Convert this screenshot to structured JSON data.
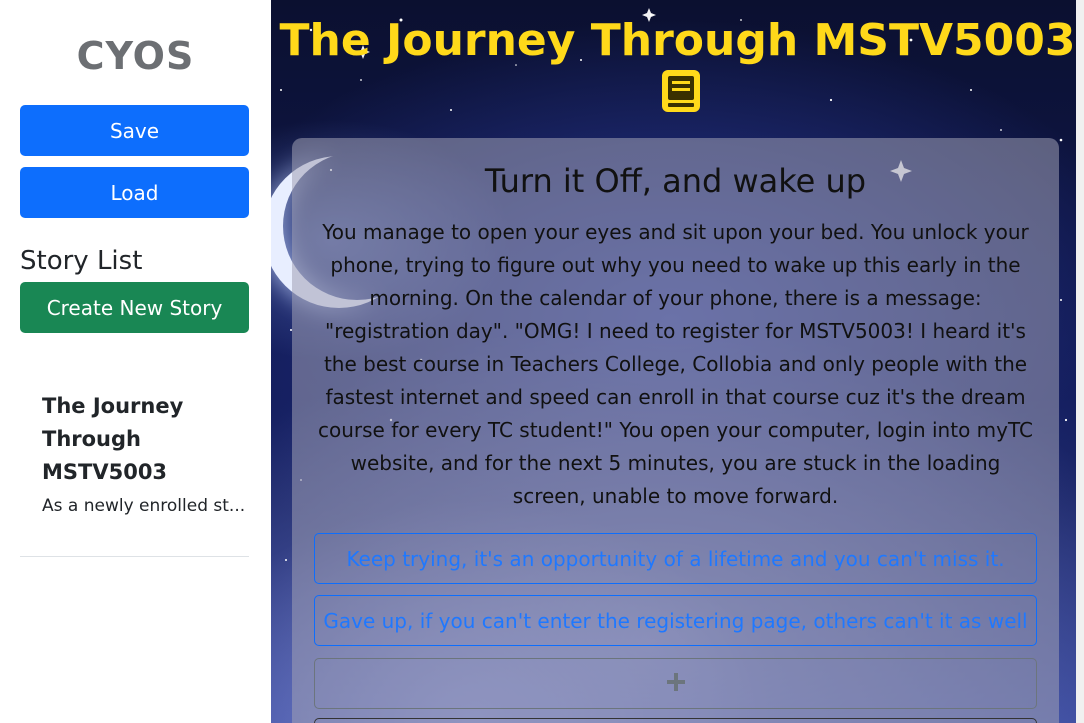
{
  "sidebar": {
    "brand": "CYOS",
    "save_label": "Save",
    "load_label": "Load",
    "story_list_title": "Story List",
    "create_label": "Create New Story",
    "stories": [
      {
        "title": "The Journey Through MSTV5003",
        "description": "As a newly enrolled st..."
      }
    ]
  },
  "main": {
    "title": "The Journey Through MSTV5003",
    "title_icon": "book-icon",
    "node": {
      "title": "Turn it Off, and wake up",
      "text": "You manage to open your eyes and sit upon your bed. You unlock your phone, trying to figure out why you need to wake up this early in the morning. On the calendar of your phone, there is a message: \"registration day\". \"OMG! I need to register for MSTV5003! I heard it's the best course in Teachers College, Collobia and only people with the fastest internet and speed can enroll in that course cuz it's the dream course for every TC student!\" You open your computer, login into myTC website, and for the next 5 minutes, you are stuck in the loading screen, unable to move forward.",
      "choices": [
        "Keep trying, it's an opportunity of a lifetime and you can't miss it.",
        "Gave up, if you can't enter the registering page, others can't it as well"
      ],
      "add_icon": "plus-icon"
    }
  },
  "colors": {
    "primary": "#0d6efd",
    "success": "#198754",
    "title_yellow": "#ffd91a",
    "brand_gray": "#6c6f73"
  }
}
